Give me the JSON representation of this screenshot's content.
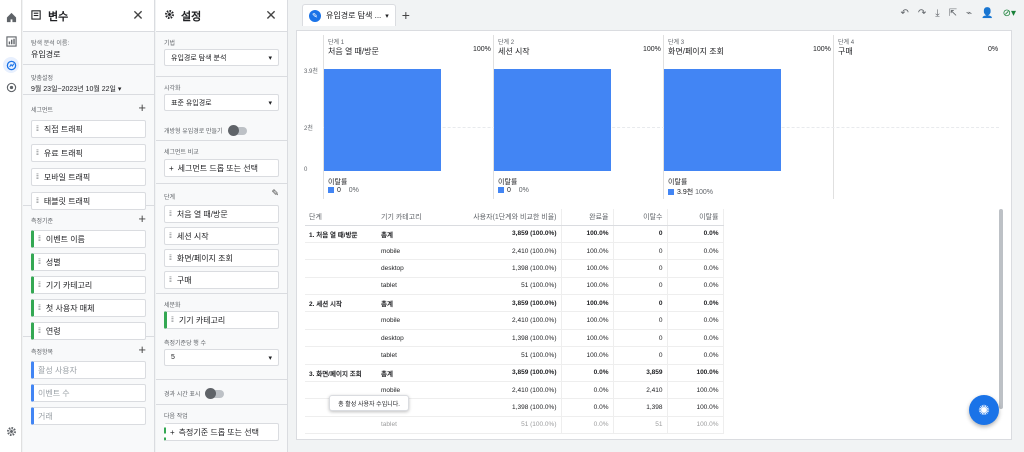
{
  "variables": {
    "title": "변수",
    "exploration_name_label": "탐색 분석 이름:",
    "exploration_name": "유입경로",
    "date_label": "맞춤설정",
    "date_value": "9월 23일~2023년 10월 22일",
    "segments_label": "세그먼트",
    "segments": [
      "직접 트래픽",
      "유료 트래픽",
      "모바일 트래픽",
      "태블릿 트래픽"
    ],
    "dimensions_label": "측정기준",
    "dimensions": [
      "이벤트 이름",
      "성별",
      "기기 카테고리",
      "첫 사용자 매체",
      "연령"
    ],
    "metrics_label": "측정항목",
    "metrics": [
      "활성 사용자",
      "이벤트 수",
      "거래"
    ]
  },
  "settings": {
    "title": "설정",
    "technique_label": "기법",
    "technique_value": "유입경로 탐색 분석",
    "visualization_label": "시각화",
    "visualization_value": "표준 유입경로",
    "open_funnel_label": "개방형 유입경로 만들기",
    "segment_compare_label": "세그먼트 비교",
    "segment_drop_label": "세그먼트 드롭 또는 선택",
    "steps_label": "단계",
    "steps": [
      "처음 열 때/방문",
      "세션 시작",
      "화면/페이지 조회",
      "구매"
    ],
    "breakdown_label": "세분화",
    "breakdown_value": "기기 카테고리",
    "rows_per_dim_label": "측정기준당 행 수",
    "rows_per_dim_value": "5",
    "elapsed_time_label": "경과 시간 표시",
    "next_action_label": "다음 작업",
    "next_action_drop": "측정기준 드롭 또는 선택"
  },
  "tab": {
    "label": "유입경로 탐색 ..."
  },
  "funnel": {
    "y_ticks": [
      "3.9천",
      "2천",
      "0"
    ],
    "steps": [
      {
        "label": "단계 1",
        "name": "처음 열 때/방문",
        "pct": "100%",
        "drop_label": "이탈률",
        "drop_count": "0",
        "drop_pct": "0%"
      },
      {
        "label": "단계 2",
        "name": "세션 시작",
        "pct": "100%",
        "drop_label": "이탈률",
        "drop_count": "0",
        "drop_pct": "0%"
      },
      {
        "label": "단계 3",
        "name": "화면/페이지 조회",
        "pct": "100%",
        "drop_label": "이탈률",
        "drop_count": "3.9천",
        "drop_pct": "100%"
      },
      {
        "label": "단계 4",
        "name": "구매",
        "pct": "0%"
      }
    ]
  },
  "chart_data": {
    "type": "bar",
    "categories": [
      "처음 열 때/방문",
      "세션 시작",
      "화면/페이지 조회",
      "구매"
    ],
    "values": [
      3859,
      3859,
      3859,
      0
    ],
    "ylim": [
      0,
      3900
    ]
  },
  "table": {
    "headers": [
      "단계",
      "기기 카테고리",
      "사용자(1단계와 비교한 비율)",
      "완료율",
      "이탈수",
      "이탈률"
    ],
    "rows": [
      [
        "1. 처음 열 때/방문",
        "총계",
        "3,859 (100.0%)",
        "100.0%",
        "0",
        "0.0%"
      ],
      [
        "",
        "mobile",
        "2,410 (100.0%)",
        "100.0%",
        "0",
        "0.0%"
      ],
      [
        "",
        "desktop",
        "1,398 (100.0%)",
        "100.0%",
        "0",
        "0.0%"
      ],
      [
        "",
        "tablet",
        "51 (100.0%)",
        "100.0%",
        "0",
        "0.0%"
      ],
      [
        "2. 세션 시작",
        "총계",
        "3,859 (100.0%)",
        "100.0%",
        "0",
        "0.0%"
      ],
      [
        "",
        "mobile",
        "2,410 (100.0%)",
        "100.0%",
        "0",
        "0.0%"
      ],
      [
        "",
        "desktop",
        "1,398 (100.0%)",
        "100.0%",
        "0",
        "0.0%"
      ],
      [
        "",
        "tablet",
        "51 (100.0%)",
        "100.0%",
        "0",
        "0.0%"
      ],
      [
        "3. 화면/페이지 조회",
        "총계",
        "3,859 (100.0%)",
        "0.0%",
        "3,859",
        "100.0%"
      ],
      [
        "",
        "mobile",
        "2,410 (100.0%)",
        "0.0%",
        "2,410",
        "100.0%"
      ],
      [
        "",
        "desktop",
        "1,398 (100.0%)",
        "0.0%",
        "1,398",
        "100.0%"
      ],
      [
        "",
        "tablet",
        "51 (100.0%)",
        "0.0%",
        "51",
        "100.0%"
      ]
    ]
  },
  "tooltip": "총 활성 사용자 수입니다.",
  "colors": {
    "accent": "#1a73e8",
    "bar": "#4285f4",
    "dimension": "#34a853",
    "metric": "#4285f4"
  }
}
